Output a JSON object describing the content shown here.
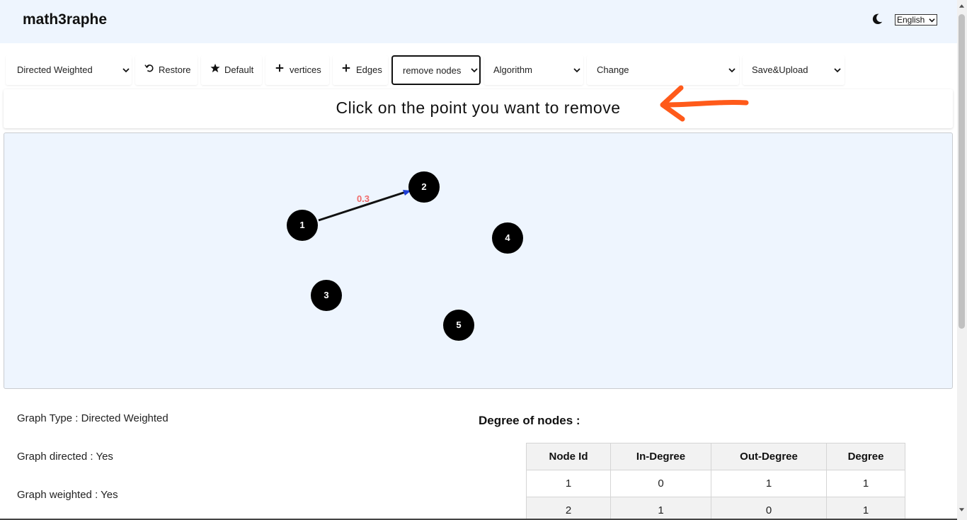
{
  "app": {
    "title": "math3raphe",
    "language": "English",
    "theme_icon": "moon-icon"
  },
  "toolbar": {
    "graph_type": "Directed Weighted",
    "restore": "Restore",
    "default": "Default",
    "vertices": "vertices",
    "edges": "Edges",
    "remove": "remove nodes",
    "algorithm": "Algorithm",
    "change": "Change",
    "save": "Save&Upload"
  },
  "instruction": "Click on the point you want to remove",
  "graph": {
    "nodes": [
      {
        "id": "1",
        "label": "1"
      },
      {
        "id": "2",
        "label": "2"
      },
      {
        "id": "3",
        "label": "3"
      },
      {
        "id": "4",
        "label": "4"
      },
      {
        "id": "5",
        "label": "5"
      }
    ],
    "edges": [
      {
        "from": "1",
        "to": "2",
        "weight": "0.3"
      }
    ],
    "colors": {
      "node": "#000000",
      "edge": "#111111",
      "arrowhead": "#1f3fd6",
      "weight": "#f06b6b",
      "arrow_annotation": "#ff5a1a"
    }
  },
  "info": {
    "type_line": "Graph Type : Directed Weighted",
    "directed_line": "Graph directed : Yes",
    "weighted_line": "Graph weighted : Yes"
  },
  "degree": {
    "title": "Degree of nodes :",
    "headers": [
      "Node Id",
      "In-Degree",
      "Out-Degree",
      "Degree"
    ],
    "rows": [
      [
        "1",
        "0",
        "1",
        "1"
      ],
      [
        "2",
        "1",
        "0",
        "1"
      ]
    ]
  }
}
